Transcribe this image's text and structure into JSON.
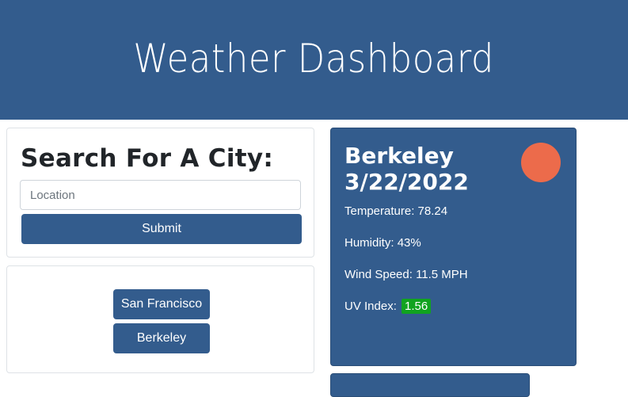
{
  "header": {
    "title": "Weather Dashboard"
  },
  "search": {
    "heading": "Search For A City:",
    "placeholder": "Location",
    "value": "",
    "submit_label": "Submit"
  },
  "history": {
    "items": [
      {
        "label": "San Francisco"
      },
      {
        "label": "Berkeley"
      }
    ]
  },
  "current": {
    "city": "Berkeley",
    "date": "3/22/2022",
    "temperature_label": "Temperature:",
    "temperature": "78.24",
    "humidity_label": "Humidity:",
    "humidity": "43%",
    "wind_label": "Wind Speed:",
    "wind": "11.5 MPH",
    "uv_label": "UV Index:",
    "uv": "1.56",
    "icon": "weather-icon"
  },
  "colors": {
    "primary": "#335c8d",
    "uv_good": "#11a31f",
    "icon": "#ec6b4b"
  }
}
